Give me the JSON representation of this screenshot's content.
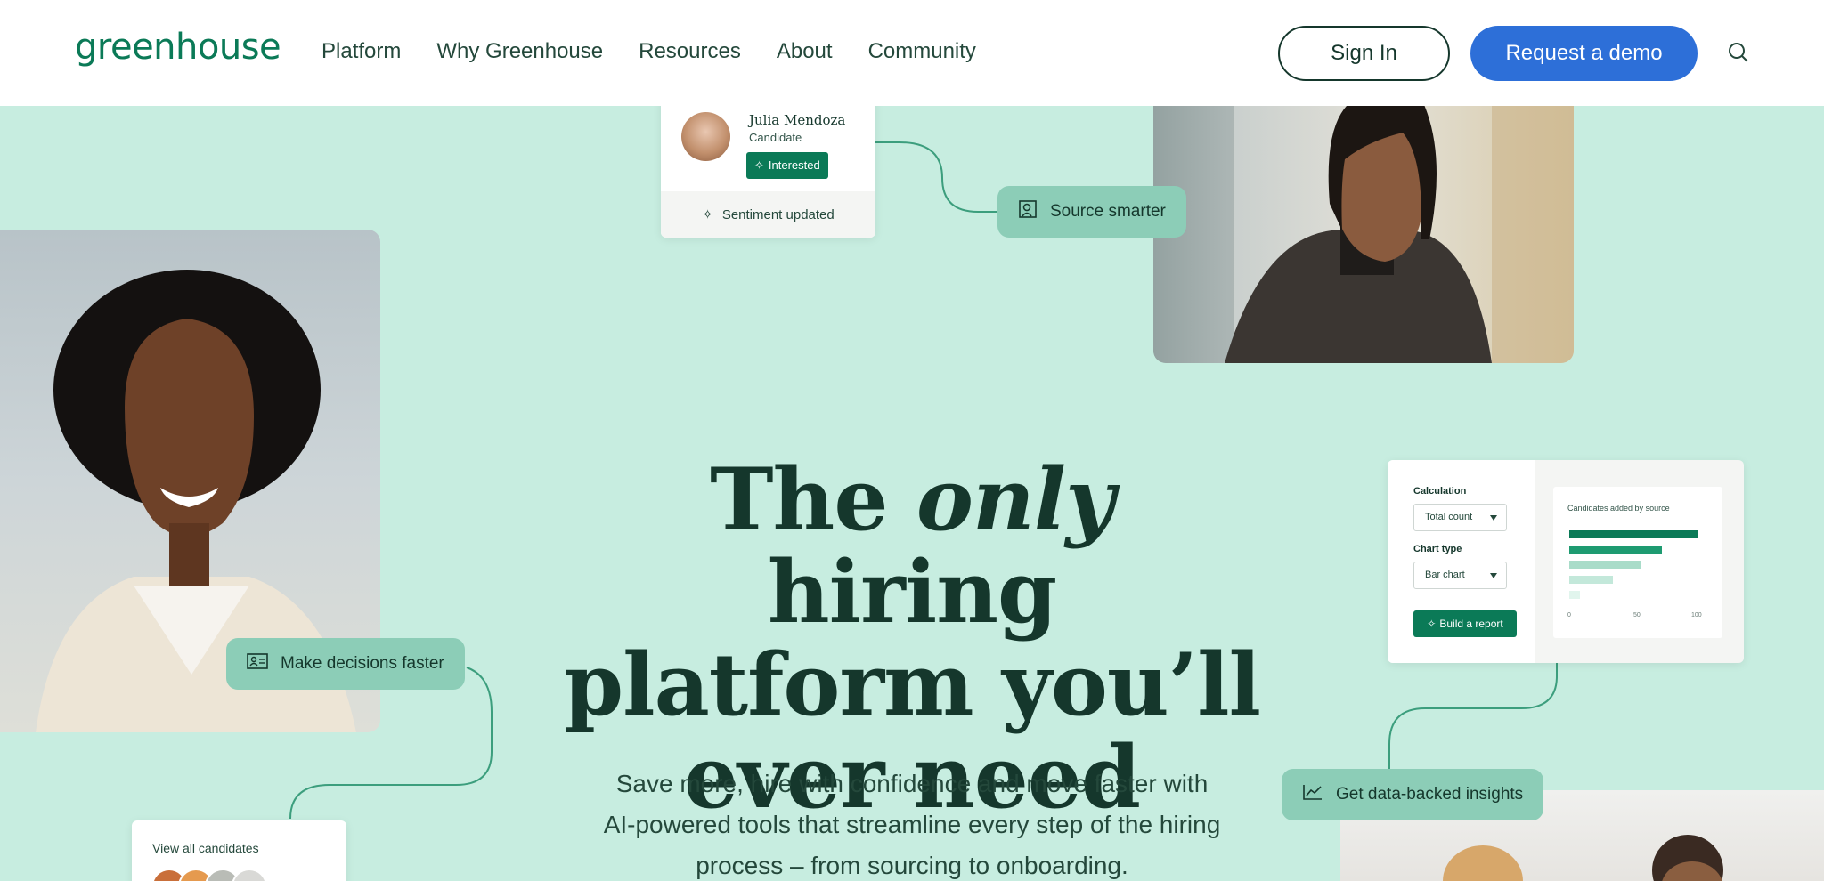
{
  "header": {
    "logo": "greenhouse",
    "nav": [
      "Platform",
      "Why Greenhouse",
      "Resources",
      "About",
      "Community"
    ],
    "sign_in": "Sign In",
    "request_demo": "Request a demo"
  },
  "hero": {
    "title_before": "The ",
    "title_em": "only",
    "title_after": " hiring platform you’ll ever need",
    "subtitle": "Save more, hire with confidence and move faster with AI-powered tools that streamline every step of the hiring process – from sourcing to onboarding."
  },
  "candidate_card": {
    "name": "Julia Mendoza",
    "role": "Candidate",
    "tag": "Interested",
    "footer": "Sentiment updated"
  },
  "pills": {
    "source": "Source smarter",
    "decide": "Make decisions faster",
    "data": "Get data-backed insights"
  },
  "report_card": {
    "calculation_label": "Calculation",
    "calculation_value": "Total count",
    "chart_type_label": "Chart type",
    "chart_type_value": "Bar chart",
    "button": "Build a report",
    "chart_title": "Candidates added by source",
    "ticks": [
      "0",
      "50",
      "100"
    ],
    "bars": [
      100,
      72,
      56,
      34,
      8
    ],
    "bar_colors": [
      "#0b7a57",
      "#1e9b71",
      "#a9dcc9",
      "#c3e8da",
      "#e1f5ed"
    ]
  },
  "view_card": {
    "title": "View all candidates"
  },
  "colors": {
    "brand_green": "#0b7a57",
    "demo_blue": "#2d6fd8",
    "background_mint": "#c7ede0",
    "pill_mint": "#8ccdb7"
  },
  "icons": {
    "search": "search-icon",
    "sparkle": "sparkle-icon",
    "source": "person-search-icon",
    "decide": "compare-icon",
    "data": "line-chart-icon"
  }
}
